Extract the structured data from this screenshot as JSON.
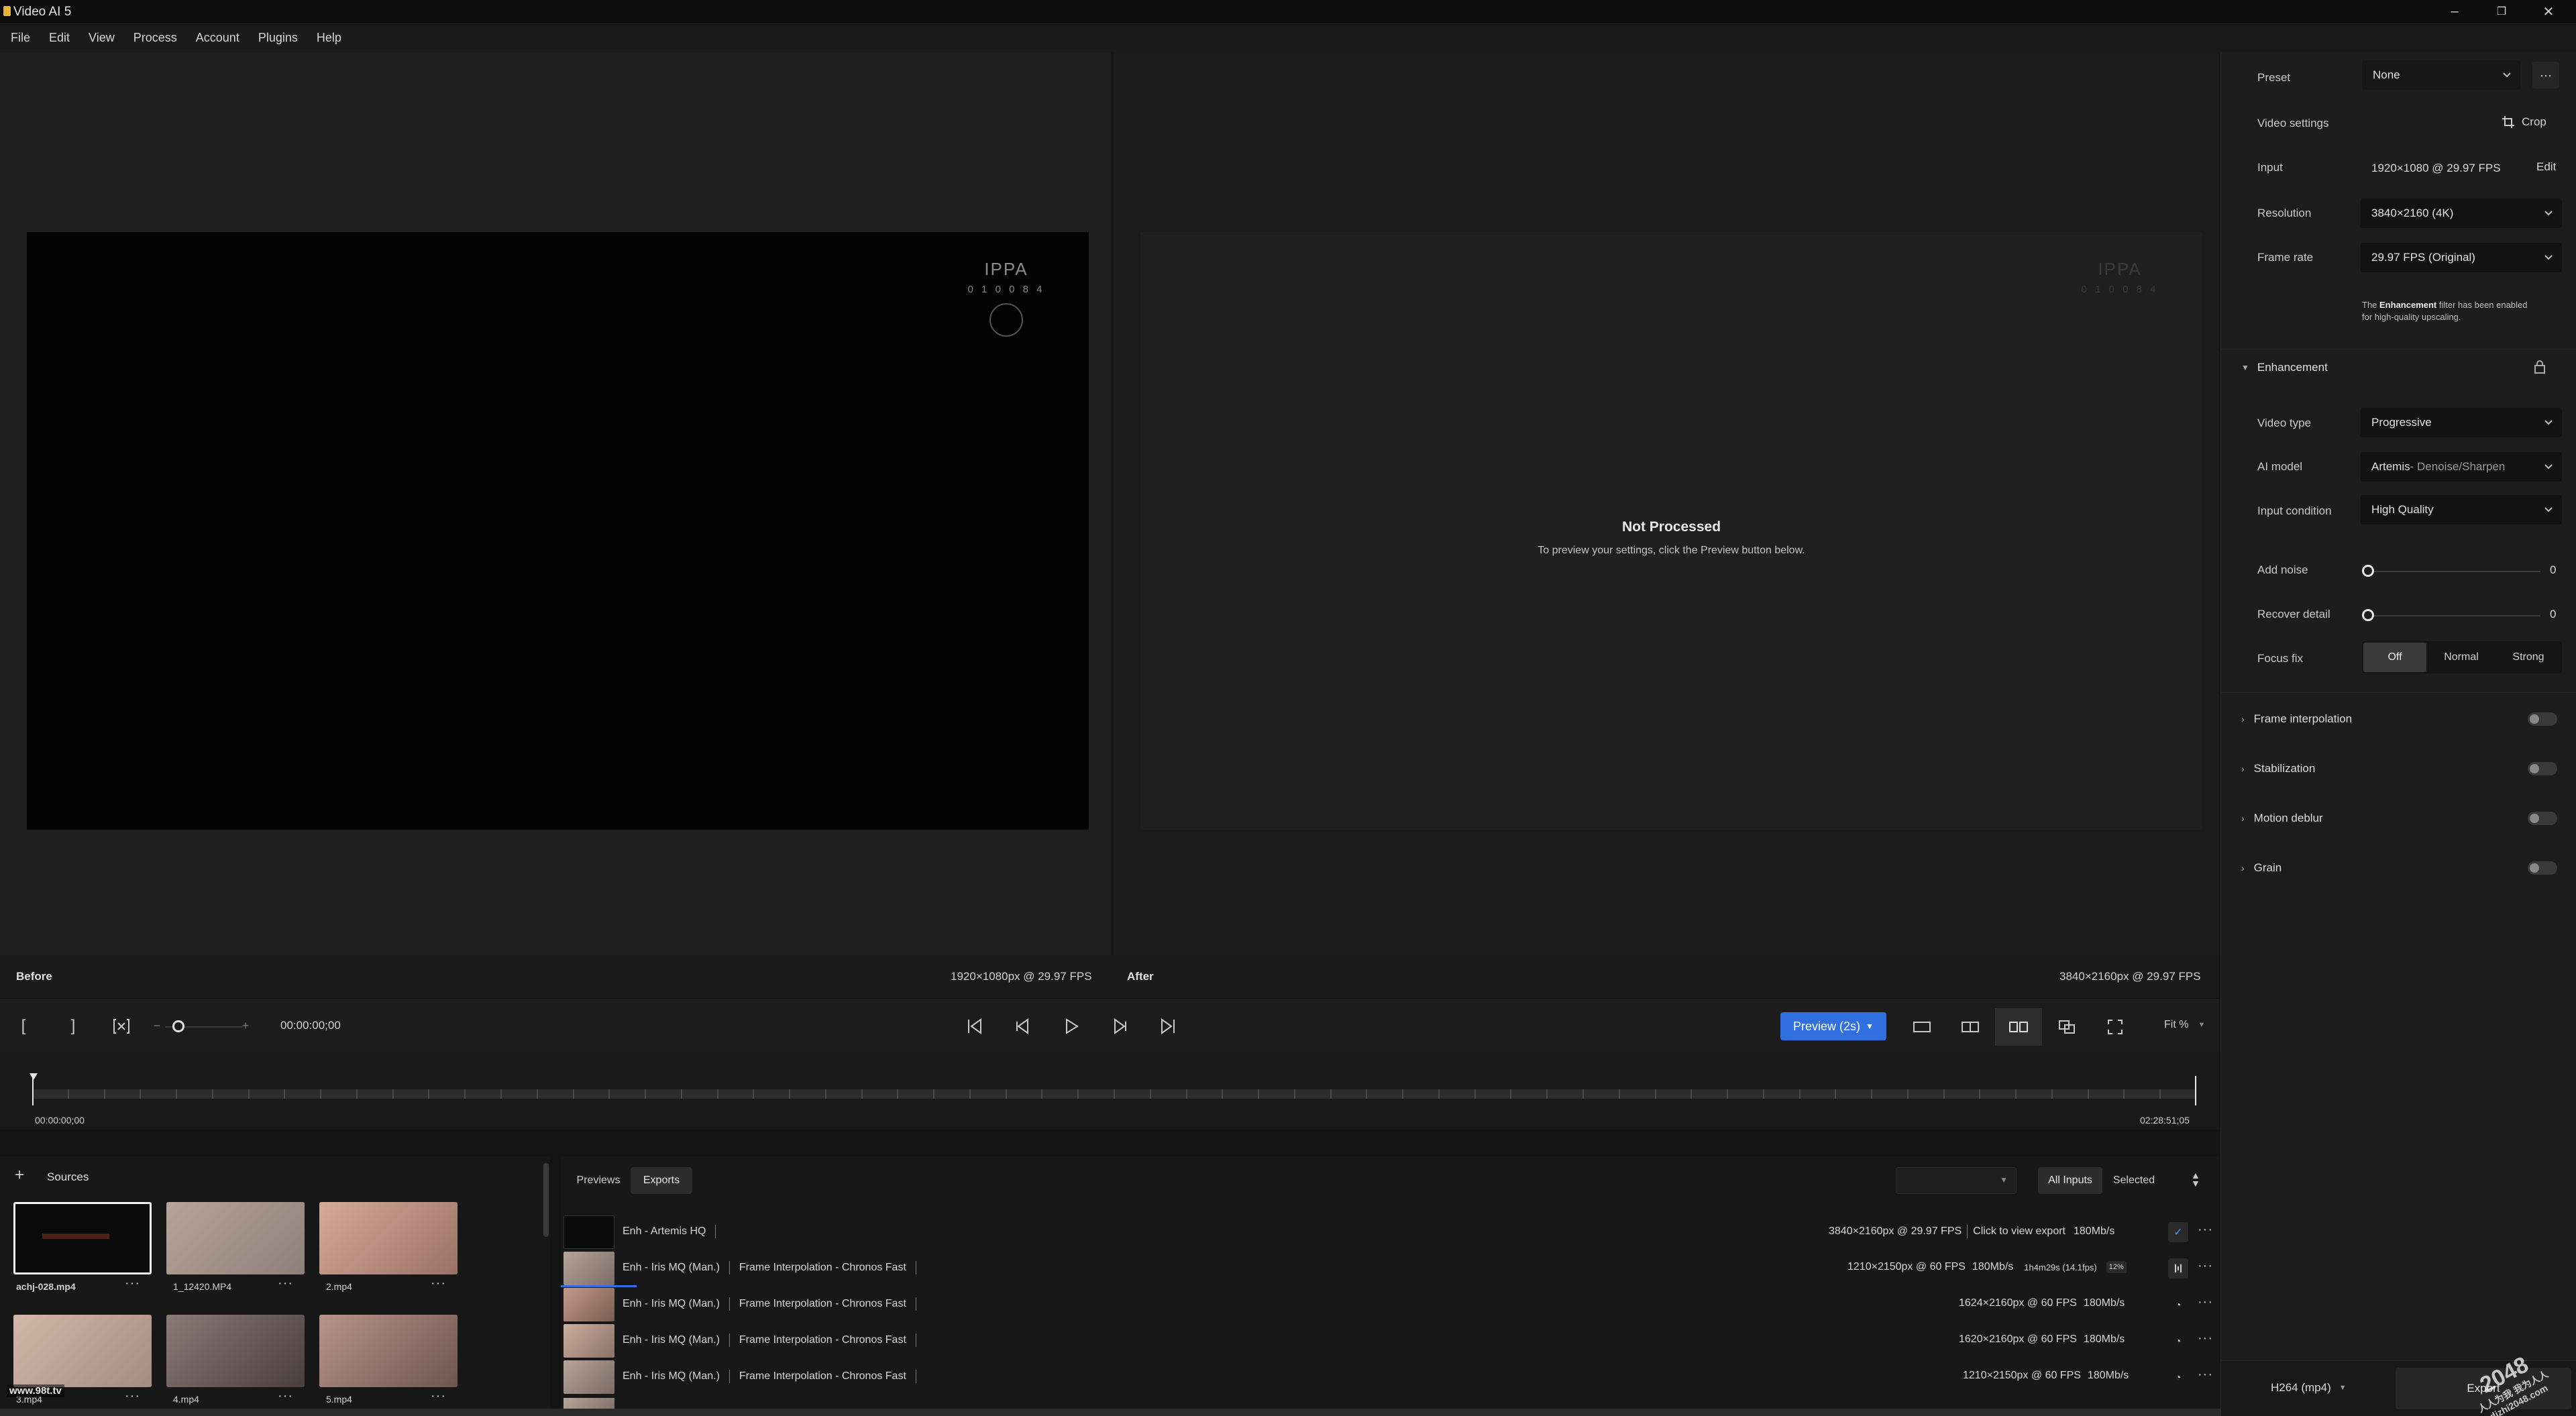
{
  "app": {
    "title": "Video AI 5"
  },
  "menu": [
    "File",
    "Edit",
    "View",
    "Process",
    "Account",
    "Plugins",
    "Help"
  ],
  "viewer": {
    "before_label": "Before",
    "before_info": "1920×1080px @ 29.97 FPS",
    "after_label": "After",
    "after_info": "3840×2160px @ 29.97 FPS",
    "not_processed_title": "Not Processed",
    "not_processed_hint": "To preview your settings, click the Preview button below.",
    "watermark_text": "IPPA",
    "watermark_code": "0 1 0 0 8 4"
  },
  "transport": {
    "timecode": "00:00:00;00",
    "preview_label": "Preview (2s)",
    "zoom_label": "Fit %"
  },
  "timeline": {
    "start": "00:00:00;00",
    "end": "02:28:51;05"
  },
  "sources": {
    "title": "Sources",
    "items": [
      {
        "name": "achj-028.mp4",
        "selected": true,
        "color": "#0a0a0a"
      },
      {
        "name": "1_12420.MP4",
        "color": "#b7a49a"
      },
      {
        "name": "2.mp4",
        "color": "#c49a8a"
      },
      {
        "name": "3.mp4",
        "color": "#cbb0a0"
      },
      {
        "name": "4.mp4",
        "color": "#6c5d5a"
      },
      {
        "name": "5.mp4",
        "color": "#a88a80"
      }
    ],
    "site_watermark": "www.98t.tv"
  },
  "queue": {
    "tabs": [
      "Previews",
      "Exports"
    ],
    "active_tab": "Exports",
    "filters": [
      "All Inputs",
      "Selected"
    ],
    "rows": [
      {
        "name": "Enh - Artemis HQ",
        "filter": "",
        "details": "3840×2160px @ 29.97 FPS",
        "extra": "Click to view export",
        "bitrate": "180Mb/s",
        "status": "done"
      },
      {
        "name": "Enh - Iris MQ (Man.)",
        "filter": "Frame Interpolation - Chronos Fast",
        "details": "1210×2150px @ 60 FPS",
        "extra": "",
        "bitrate": "180Mb/s",
        "eta": "1h4m29s (14.1fps)",
        "percent": "12%",
        "status": "running"
      },
      {
        "name": "Enh - Iris MQ (Man.)",
        "filter": "Frame Interpolation - Chronos Fast",
        "details": "1624×2160px @ 60 FPS",
        "extra": "",
        "bitrate": "180Mb/s",
        "status": "queued"
      },
      {
        "name": "Enh - Iris MQ (Man.)",
        "filter": "Frame Interpolation - Chronos Fast",
        "details": "1620×2160px @ 60 FPS",
        "extra": "",
        "bitrate": "180Mb/s",
        "status": "queued"
      },
      {
        "name": "Enh - Iris MQ (Man.)",
        "filter": "Frame Interpolation - Chronos Fast",
        "details": "1210×2150px @ 60 FPS",
        "extra": "",
        "bitrate": "180Mb/s",
        "status": "queued"
      }
    ],
    "running_progress": 0.12
  },
  "panel": {
    "preset_label": "Preset",
    "preset_value": "None",
    "video_settings_label": "Video settings",
    "crop_label": "Crop",
    "input_label": "Input",
    "input_value": "1920×1080 @ 29.97 FPS",
    "edit_label": "Edit",
    "resolution_label": "Resolution",
    "resolution_value": "3840×2160 (4K)",
    "framerate_label": "Frame rate",
    "framerate_value": "29.97 FPS (Original)",
    "enh_note_pre": "The ",
    "enh_note_bold": "Enhancement",
    "enh_note_post": " filter has been enabled",
    "enh_note_line2": "for high-quality upscaling.",
    "enhancement_label": "Enhancement",
    "video_type_label": "Video type",
    "video_type_value": "Progressive",
    "ai_model_label": "AI model",
    "ai_model_value": "Artemis",
    "ai_model_sub": " - Denoise/Sharpen",
    "input_condition_label": "Input condition",
    "input_condition_value": "High Quality",
    "add_noise_label": "Add noise",
    "add_noise_value": "0",
    "recover_detail_label": "Recover detail",
    "recover_detail_value": "0",
    "focus_fix_label": "Focus fix",
    "focus_fix_options": [
      "Off",
      "Normal",
      "Strong"
    ],
    "focus_fix_selected": "Off",
    "sections": [
      "Frame interpolation",
      "Stabilization",
      "Motion deblur",
      "Grain"
    ],
    "export_format": "H264 (mp4)",
    "export_label": "Export",
    "corner_watermark_1": "2048",
    "corner_watermark_2": "人人为我 我为人人",
    "corner_watermark_3": "dizhi2048.com"
  }
}
